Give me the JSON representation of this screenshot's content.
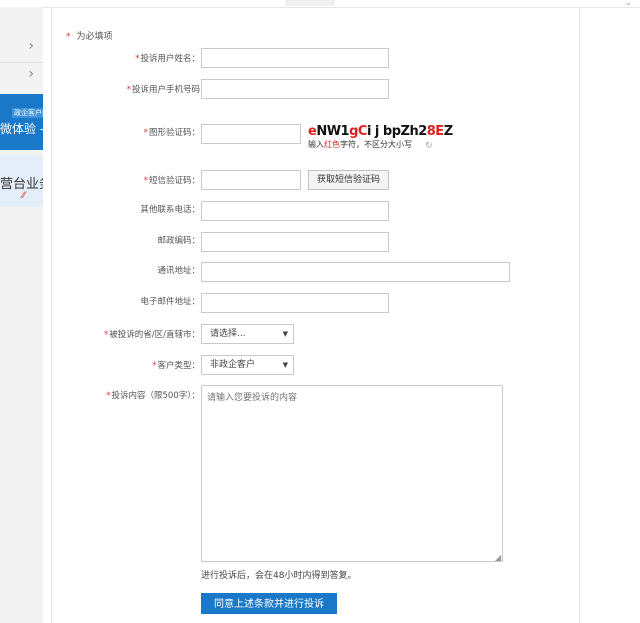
{
  "required_note": "为必填项",
  "required_star": "*",
  "fields": {
    "name": {
      "label": "投诉用户姓名：",
      "required": true,
      "value": ""
    },
    "phone": {
      "label": "投诉用户手机号码",
      "required": true,
      "value": ""
    },
    "captcha": {
      "label": "图形验证码：",
      "required": true,
      "value": "",
      "code_parts": [
        "e",
        "NW1",
        "gC",
        "i j bpZh2",
        "8E",
        "Z"
      ],
      "hint_parts": [
        "输入",
        "红色",
        "字符，不区分大小写"
      ]
    },
    "sms": {
      "label": "短信验证码：",
      "required": true,
      "value": "",
      "button": "获取短信验证码"
    },
    "other_phone": {
      "label": "其他联系电话：",
      "required": false,
      "value": ""
    },
    "postcode": {
      "label": "邮政编码：",
      "required": false,
      "value": ""
    },
    "address": {
      "label": "通讯地址：",
      "required": false,
      "value": ""
    },
    "email": {
      "label": "电子邮件地址：",
      "required": false,
      "value": ""
    },
    "province": {
      "label": "被投诉的省/区/直辖市：",
      "required": true,
      "selected": "请选择..."
    },
    "customer_type": {
      "label": "客户类型：",
      "required": true,
      "selected": "非政企客户"
    },
    "content": {
      "label": "投诉内容（限500字）：",
      "required": true,
      "placeholder": "请输入您要投诉的内容"
    }
  },
  "note": "进行投诉后，会在48小时内得到答复。",
  "submit": "同意上述条款并进行投诉",
  "sidebar": {
    "promo_blue_tag": "政企客户端",
    "promo_blue_text": "微体验 -",
    "promo_light_text": "营台业务"
  },
  "colors": {
    "accent": "#1a78c8",
    "required": "#d33333"
  }
}
